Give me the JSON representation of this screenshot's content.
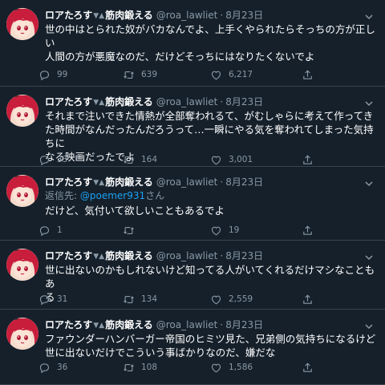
{
  "tweets": [
    {
      "display_name": "ロアたろす",
      "display_name_suffix": "筋肉鍛える",
      "handle": "@roa_lawliet",
      "separator": "·",
      "date": "8月23日",
      "reply_prefix": "",
      "reply_mention": "",
      "reply_suffix": "",
      "text": "世の中はとられた奴がバカなんでよ、上手くやられたらそっちの方が正し\nい\n人間の方が悪魔なのだ、だけどそっちにはなりたくないでよ",
      "replies": "99",
      "retweets": "639",
      "likes": "6,217"
    },
    {
      "display_name": "ロアたろす",
      "display_name_suffix": "筋肉鍛える",
      "handle": "@roa_lawliet",
      "separator": "·",
      "date": "8月23日",
      "reply_prefix": "",
      "reply_mention": "",
      "reply_suffix": "",
      "text": "それまで注いできた情熱が全部奪われるて、がむしゃらに考えて作ってき\nた時間がなんだったんだろうって…一瞬にやる気を奪われてしまった気持ちに\nなる映画だったでよ",
      "replies": "33",
      "retweets": "164",
      "likes": "3,001"
    },
    {
      "display_name": "ロアたろす",
      "display_name_suffix": "筋肉鍛える",
      "handle": "@roa_lawliet",
      "separator": "·",
      "date": "8月23日",
      "reply_prefix": "返信先: ",
      "reply_mention": "@poemer931",
      "reply_suffix": "さん",
      "text": "だけど、気付いて欲しいこともあるでよ",
      "replies": "1",
      "retweets": "",
      "likes": "19"
    },
    {
      "display_name": "ロアたろす",
      "display_name_suffix": "筋肉鍛える",
      "handle": "@roa_lawliet",
      "separator": "·",
      "date": "8月23日",
      "reply_prefix": "",
      "reply_mention": "",
      "reply_suffix": "",
      "text": "世に出ないのかもしれないけど知ってる人がいてくれるだけマシなこともあ\nる",
      "replies": "31",
      "retweets": "134",
      "likes": "2,559"
    },
    {
      "display_name": "ロアたろす",
      "display_name_suffix": "筋肉鍛える",
      "handle": "@roa_lawliet",
      "separator": "·",
      "date": "8月23日",
      "reply_prefix": "",
      "reply_mention": "",
      "reply_suffix": "",
      "text": "ファウンダーハンバーガー帝国のヒミツ見た、兄弟側の気持ちになるけど\n世に出ないだけでこういう事ばかりなのだ、嫌だな",
      "replies": "36",
      "retweets": "108",
      "likes": "1,586"
    }
  ],
  "icons": {
    "bat": "bat-emoji-icon",
    "caret": "chevron-down-icon",
    "reply": "reply-icon",
    "retweet": "retweet-icon",
    "like": "heart-icon",
    "share": "share-icon"
  },
  "colors": {
    "background": "#15202b",
    "border": "#38444d",
    "muted": "#8899a6",
    "link": "#1da1f2",
    "text": "#ffffff"
  }
}
